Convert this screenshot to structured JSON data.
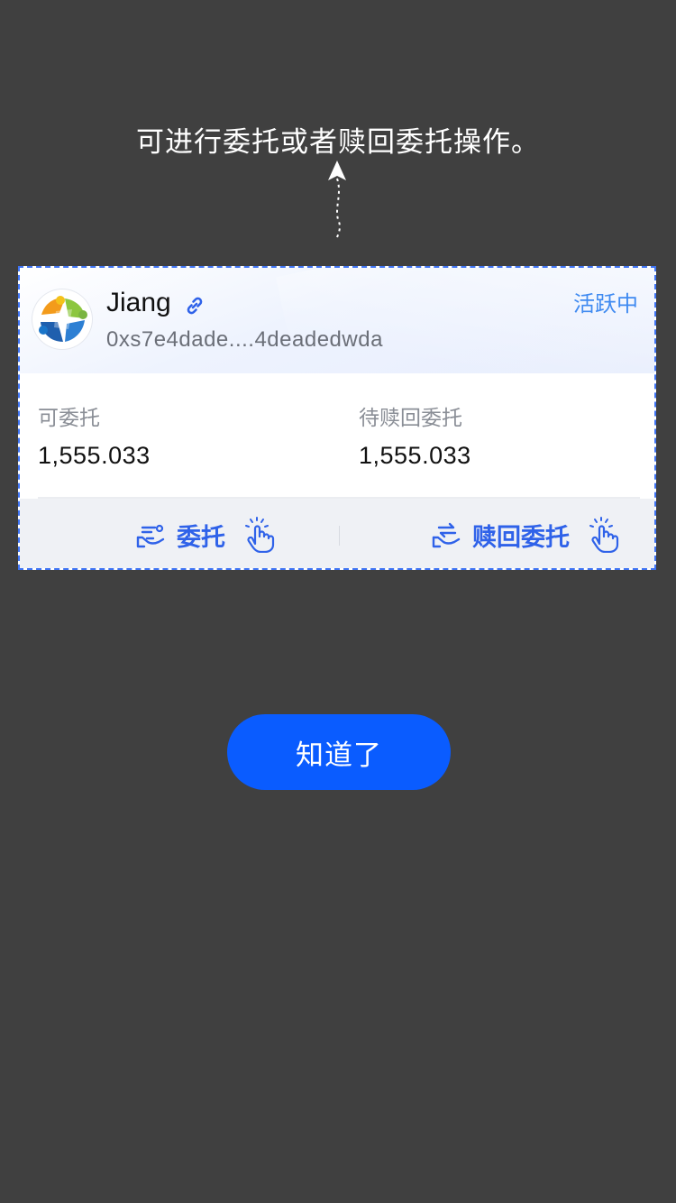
{
  "hint": {
    "text": "可进行委托或者赎回委托操作。"
  },
  "validator": {
    "avatar_icon": "validator-logo-icon",
    "name": "Jiang",
    "link_icon": "link-icon",
    "address": "0xs7e4dade....4deadedwda",
    "status": "活跃中",
    "status_color": "#3f8af1"
  },
  "stats": {
    "delegatable_label": "可委托",
    "delegatable_value": "1,555.033",
    "pending_redeem_label": "待赎回委托",
    "pending_redeem_value": "1,555.033"
  },
  "actions": {
    "delegate_label": "委托",
    "delegate_icon": "hand-delegate-icon",
    "redeem_label": "赎回委托",
    "redeem_icon": "hand-redeem-icon",
    "tap_icon": "tap-hand-icon",
    "accent_color": "#2f62e9"
  },
  "footer": {
    "confirm_label": "知道了",
    "confirm_color": "#0a5cff"
  },
  "colors": {
    "overlay_background": "#404040",
    "highlight_border": "#3f74f4"
  }
}
